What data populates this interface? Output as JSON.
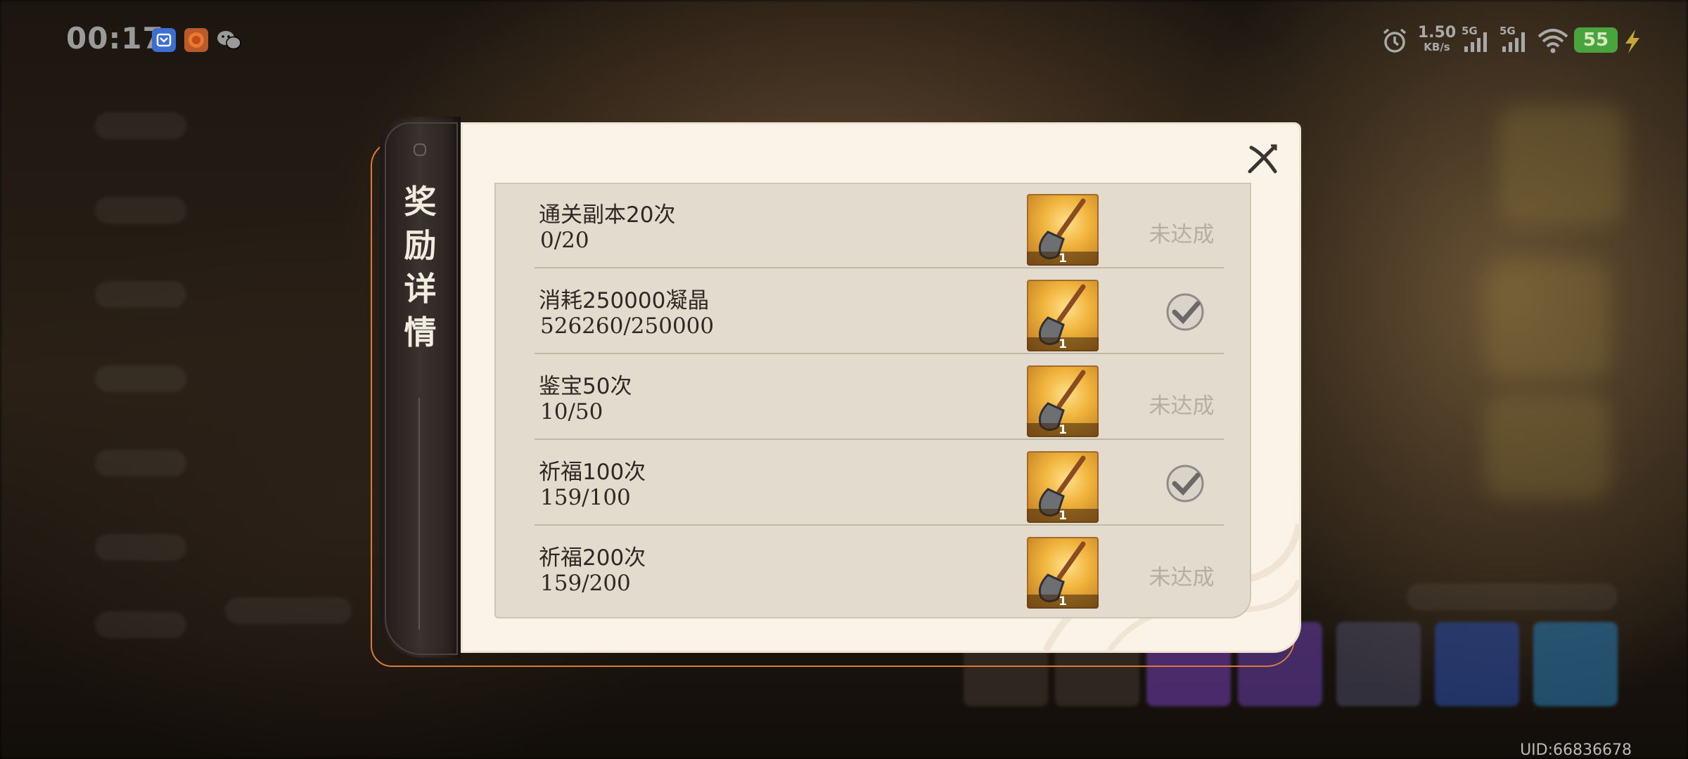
{
  "status_bar": {
    "time": "00:17",
    "net_speed_value": "1.50",
    "net_speed_unit": "KB/s",
    "signal1_label": "5G",
    "signal2_label": "5G",
    "battery": "55",
    "apps": [
      "bluetooth-app-icon",
      "game-app-icon",
      "wechat-icon"
    ]
  },
  "dialog": {
    "tab_title": "奖\n励\n详\n情",
    "close_icon": "close-icon",
    "rows": [
      {
        "title": "通关副本20次",
        "progress": "0/20",
        "reward_count": "1",
        "status": "未达成",
        "completed": false
      },
      {
        "title": "消耗250000凝晶",
        "progress": "526260/250000",
        "reward_count": "1",
        "status": "",
        "completed": true
      },
      {
        "title": "鉴宝50次",
        "progress": "10/50",
        "reward_count": "1",
        "status": "未达成",
        "completed": false
      },
      {
        "title": "祈福100次",
        "progress": "159/100",
        "reward_count": "1",
        "status": "",
        "completed": true
      },
      {
        "title": "祈福200次",
        "progress": "159/200",
        "reward_count": "1",
        "status": "未达成",
        "completed": false
      }
    ]
  },
  "footer": {
    "uid": "UID:66836678"
  },
  "colors": {
    "accent_orange": "#d77a3c",
    "panel_bg": "#fbf3e7",
    "list_bg": "#e3dbcd",
    "battery_green": "#4aa43e"
  }
}
